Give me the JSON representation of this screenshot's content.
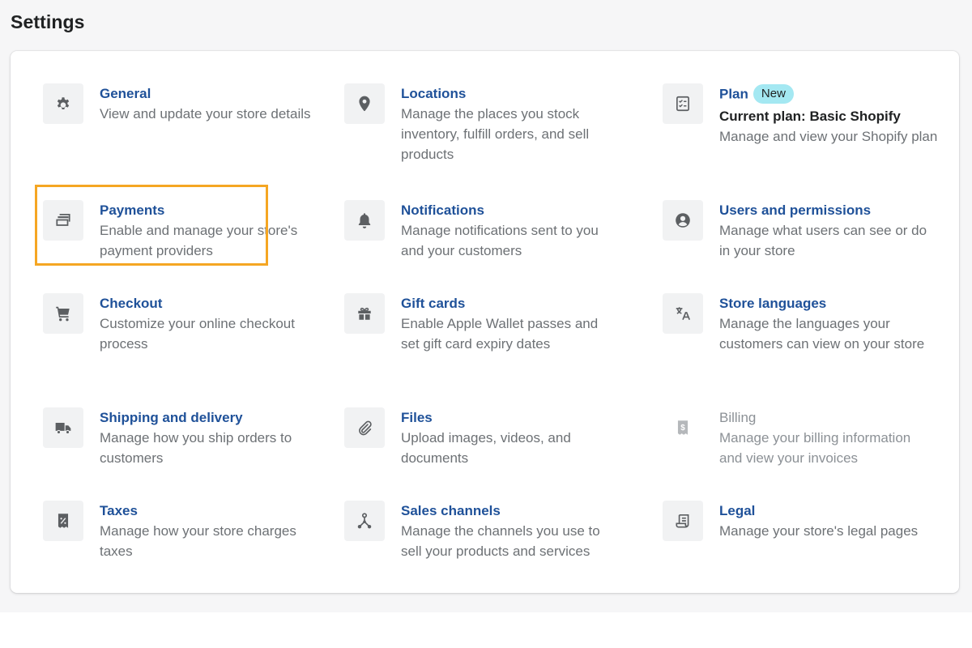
{
  "page": {
    "title": "Settings"
  },
  "colors": {
    "link": "#1f5199",
    "text_subdued": "#6d7175",
    "text_disabled": "#8c9196",
    "icon_bg": "#f1f2f3",
    "badge_bg": "#a4e8f2",
    "highlight": "#f5a623"
  },
  "items": {
    "general": {
      "title": "General",
      "desc": "View and update your store details",
      "icon": "gear-icon"
    },
    "locations": {
      "title": "Locations",
      "desc": "Manage the places you stock inventory, fulfill orders, and sell products",
      "icon": "location-pin-icon"
    },
    "plan": {
      "title": "Plan",
      "badge": "New",
      "subtitle": "Current plan: Basic Shopify",
      "desc": "Manage and view your Shopify plan",
      "icon": "plan-list-icon"
    },
    "payments": {
      "title": "Payments",
      "desc": "Enable and manage your store's payment providers",
      "icon": "card-icon"
    },
    "notifications": {
      "title": "Notifications",
      "desc": "Manage notifications sent to you and your customers",
      "icon": "bell-icon"
    },
    "users": {
      "title": "Users and permissions",
      "desc": "Manage what users can see or do in your store",
      "icon": "user-icon"
    },
    "checkout": {
      "title": "Checkout",
      "desc": "Customize your online checkout process",
      "icon": "cart-icon"
    },
    "gift_cards": {
      "title": "Gift cards",
      "desc": "Enable Apple Wallet passes and set gift card expiry dates",
      "icon": "gift-icon"
    },
    "store_languages": {
      "title": "Store languages",
      "desc": "Manage the languages your customers can view on your store",
      "icon": "translate-icon"
    },
    "shipping": {
      "title": "Shipping and delivery",
      "desc": "Manage how you ship orders to customers",
      "icon": "truck-icon"
    },
    "files": {
      "title": "Files",
      "desc": "Upload images, videos, and documents",
      "icon": "paperclip-icon"
    },
    "billing": {
      "title": "Billing",
      "desc": "Manage your billing information and view your invoices",
      "icon": "invoice-icon",
      "disabled": true
    },
    "taxes": {
      "title": "Taxes",
      "desc": "Manage how your store charges taxes",
      "icon": "tax-receipt-icon"
    },
    "sales_channels": {
      "title": "Sales channels",
      "desc": "Manage the channels you use to sell your products and services",
      "icon": "channels-icon"
    },
    "legal": {
      "title": "Legal",
      "desc": "Manage your store's legal pages",
      "icon": "legal-document-icon"
    }
  }
}
